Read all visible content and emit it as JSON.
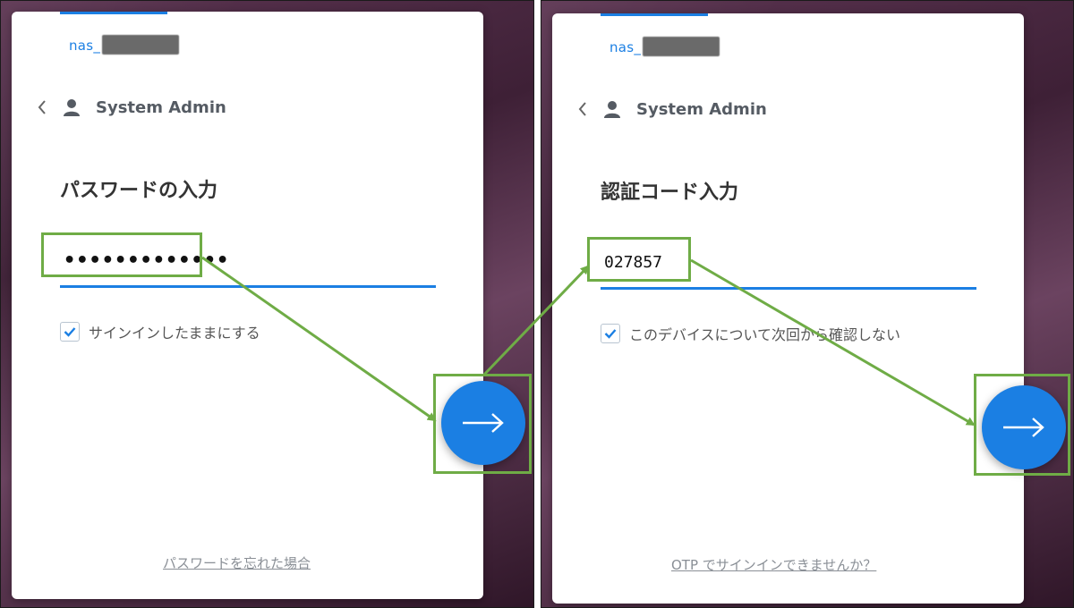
{
  "left_panel": {
    "server_name": "nas_",
    "user_name": "System Admin",
    "form_title": "パスワードの入力",
    "password_value": "•••••••••••••",
    "checkbox_label": "サインインしたままにする",
    "checkbox_checked": true,
    "bottom_link": "パスワードを忘れた場合"
  },
  "right_panel": {
    "server_name": "nas_",
    "user_name": "System Admin",
    "form_title": "認証コード入力",
    "code_value": "027857",
    "checkbox_label": "このデバイスについて次回から確認しない",
    "checkbox_checked": true,
    "bottom_link": "OTP でサインインできませんか？"
  },
  "colors": {
    "accent": "#1b7fe3",
    "highlight": "#6fac46",
    "background": "#4a2a42"
  }
}
